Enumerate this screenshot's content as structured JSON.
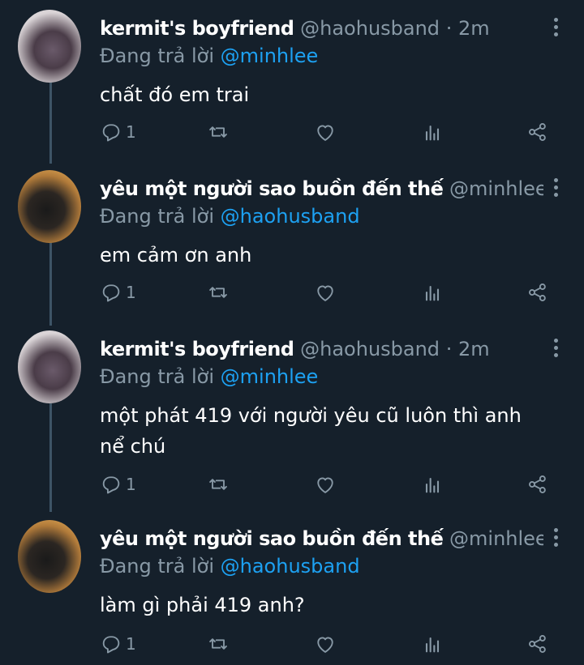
{
  "colors": {
    "background": "#15202b",
    "text": "#ffffff",
    "muted": "#8899a6",
    "link": "#1da1f2"
  },
  "tweets": [
    {
      "name": "kermit's boyfriend",
      "handle": "@haohusband",
      "dot": "·",
      "time": "2m",
      "replying_prefix": "Đang trả lời ",
      "replying_to": "@minhlee",
      "text": "chất đó em trai",
      "reply_count": "1",
      "avatar": "kermit-avatar"
    },
    {
      "name": "yêu một người sao buồn đến thế",
      "handle": "@minhlee",
      "dot": "·...",
      "time": "",
      "replying_prefix": "Đang trả lời ",
      "replying_to": "@haohusband",
      "text": "em cảm ơn anh",
      "reply_count": "1",
      "avatar": "minhlee-avatar"
    },
    {
      "name": "kermit's boyfriend",
      "handle": "@haohusband",
      "dot": "·",
      "time": "2m",
      "replying_prefix": "Đang trả lời ",
      "replying_to": "@minhlee",
      "text": "một phát 419 với người yêu cũ luôn thì anh nể chú",
      "reply_count": "1",
      "avatar": "kermit-avatar"
    },
    {
      "name": "yêu một người sao buồn đến thế",
      "handle": "@minhlee",
      "dot": "·...",
      "time": "",
      "replying_prefix": "Đang trả lời ",
      "replying_to": "@haohusband",
      "text": "làm gì phải 419 anh?",
      "reply_count": "1",
      "avatar": "minhlee-avatar"
    }
  ],
  "icons": {
    "reply": "reply-icon",
    "retweet": "retweet-icon",
    "like": "heart-icon",
    "stats": "analytics-icon",
    "share": "share-icon",
    "menu": "more-vertical-icon"
  }
}
